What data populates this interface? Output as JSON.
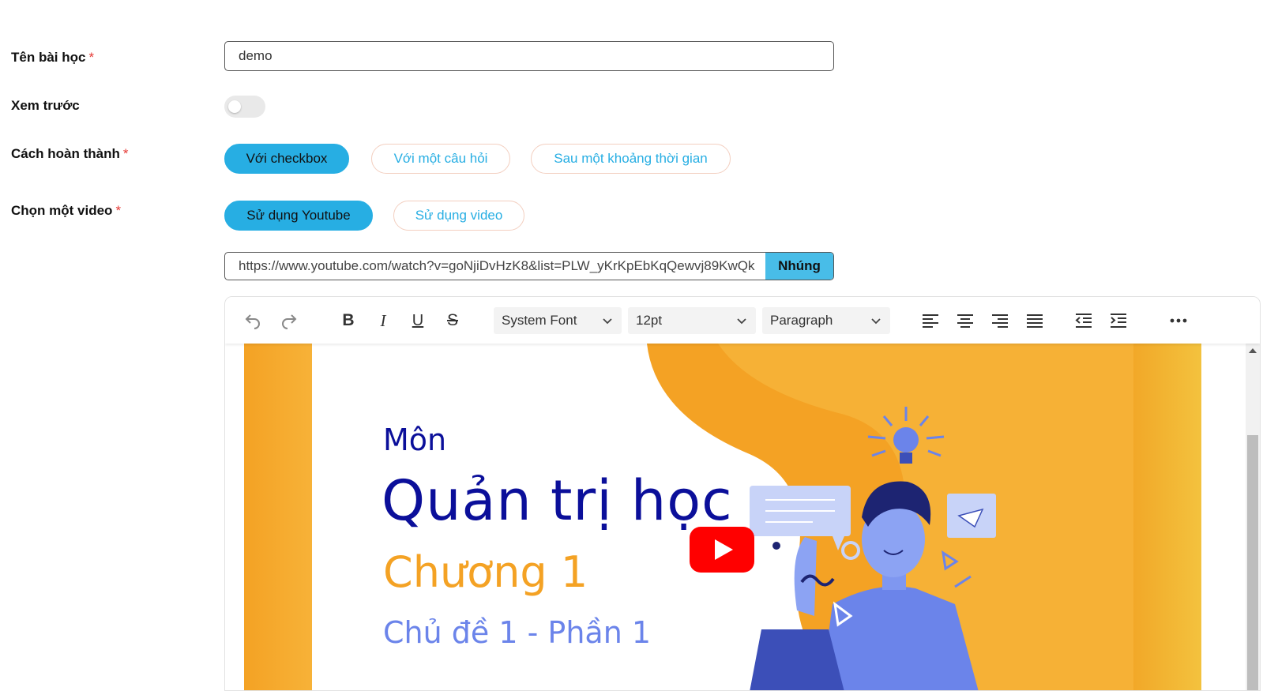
{
  "form": {
    "lesson_name_label": "Tên bài học",
    "required_mark": "*",
    "lesson_name_value": "demo",
    "preview_label": "Xem trước",
    "preview_enabled": false,
    "completion_label": "Cách hoàn thành",
    "completion_options": [
      "Với checkbox",
      "Với một câu hỏi",
      "Sau một khoảng thời gian"
    ],
    "completion_selected": "Với checkbox",
    "video_label": "Chọn một video",
    "video_options": [
      "Sử dụng Youtube",
      "Sử dụng video"
    ],
    "video_selected": "Sử dụng Youtube",
    "video_url": "https://www.youtube.com/watch?v=goNjiDvHzK8&list=PLW_yKrKpEbKqQewvj89KwQk",
    "embed_label": "Nhúng"
  },
  "editor": {
    "toolbar": {
      "font_family": "System Font",
      "font_size": "12pt",
      "block_format": "Paragraph",
      "icons": [
        "undo-icon",
        "redo-icon",
        "bold-icon",
        "italic-icon",
        "underline-icon",
        "strikethrough-icon",
        "align-left-icon",
        "align-center-icon",
        "align-right-icon",
        "align-justify-icon",
        "outdent-icon",
        "indent-icon",
        "more-icon"
      ]
    },
    "video_thumbnail": {
      "subject": "Môn",
      "title": "Quản trị học",
      "chapter": "Chương 1",
      "topic": "Chủ đề 1 - Phần 1"
    }
  },
  "colors": {
    "accent": "#27aee3",
    "required": "#e53935",
    "thumb_orange": "#f4a224",
    "thumb_navy": "#0b0f9a",
    "youtube_red": "#ff0000"
  }
}
